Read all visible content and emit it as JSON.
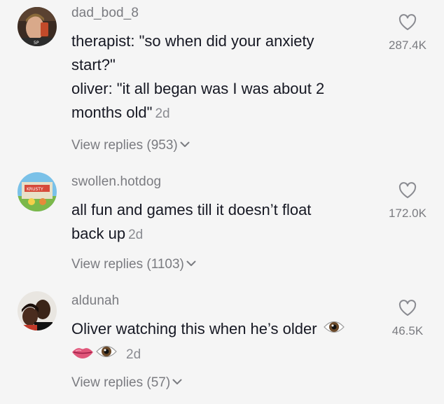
{
  "comments": [
    {
      "username": "dad_bod_8",
      "avatar_icon": "user-avatar-photo",
      "text_lines": [
        "therapist: \"so when did your anxiety",
        "start?\"",
        "oliver: \"it all began was I was about 2",
        "months old\""
      ],
      "age": "2d",
      "view_replies": "View replies (953)",
      "likes": "287.4K"
    },
    {
      "username": "swollen.hotdog",
      "avatar_icon": "cartoon-avatar",
      "text_lines": [
        "all fun and games till it doesn’t float",
        "back up"
      ],
      "age": "2d",
      "view_replies": "View replies (1103)",
      "likes": "172.0K"
    },
    {
      "username": "aldunah",
      "avatar_icon": "user-avatar-photo",
      "text_lines": [
        "Oliver watching this when he’s older"
      ],
      "emojis": [
        "eye-emoji",
        "lips-emoji",
        "eye-emoji"
      ],
      "age": "2d",
      "view_replies": "View replies (57)",
      "likes": "46.5K"
    }
  ],
  "colors": {
    "background": "#f5f5f5",
    "text": "#161823",
    "secondary": "#7a7b80"
  }
}
